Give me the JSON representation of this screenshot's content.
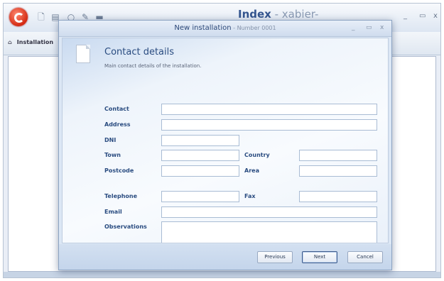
{
  "app": {
    "title": "Index",
    "title_suffix": " - xabier-",
    "tab_label": "Installation",
    "quick_access_icons": [
      "new-doc-icon",
      "save-icon",
      "search-icon",
      "edit-icon",
      "menu-icon"
    ],
    "window_buttons": [
      "_",
      "▭",
      "x"
    ]
  },
  "dialog": {
    "title": "New installation",
    "subtitle": " - Number 0001",
    "window_buttons": [
      "_",
      "▭",
      "x"
    ],
    "heading": "Contact details",
    "description": "Main contact details of the installation.",
    "fields": {
      "contact": {
        "label": "Contact",
        "value": ""
      },
      "address": {
        "label": "Address",
        "value": ""
      },
      "dni": {
        "label": "DNI",
        "value": ""
      },
      "town": {
        "label": "Town",
        "value": ""
      },
      "country": {
        "label": "Country",
        "value": ""
      },
      "postcode": {
        "label": "Postcode",
        "value": ""
      },
      "area": {
        "label": "Area",
        "value": ""
      },
      "telephone": {
        "label": "Telephone",
        "value": ""
      },
      "fax": {
        "label": "Fax",
        "value": ""
      },
      "email": {
        "label": "Email",
        "value": ""
      },
      "observations": {
        "label": "Observations",
        "value": ""
      }
    },
    "buttons": {
      "previous": "Previous",
      "next": "Next",
      "cancel": "Cancel"
    }
  },
  "colors": {
    "accent": "#2a4c80",
    "brand_logo": "#d42a12"
  }
}
